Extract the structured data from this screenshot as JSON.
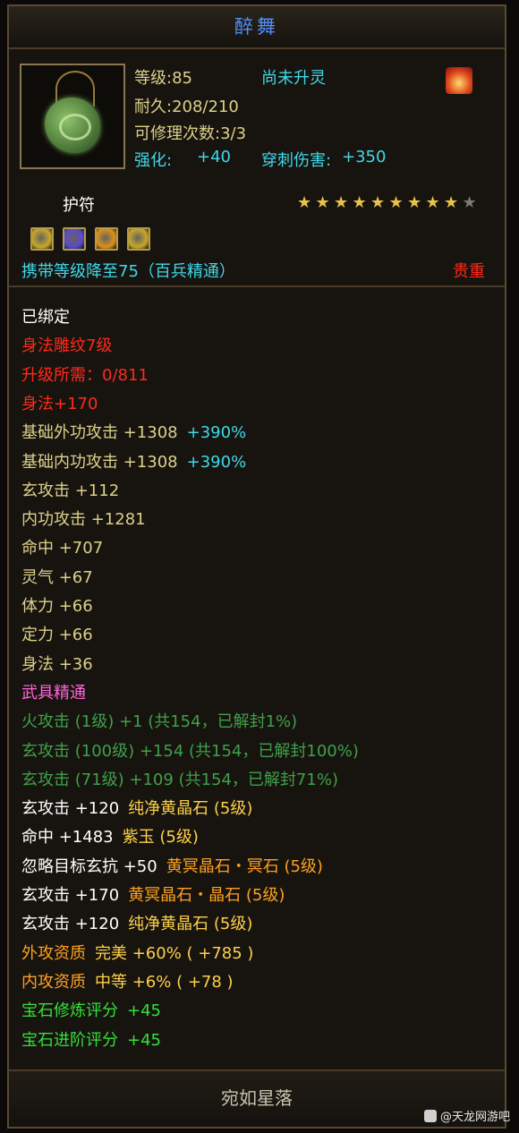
{
  "title": "醉舞",
  "item": {
    "level": "等级:85",
    "spirit": "尚未升灵",
    "durability": "耐久:208/210",
    "repair": "可修理次数:3/3",
    "enhance_label": "强化:",
    "enhance_value": "+40",
    "pierce_label": "穿刺伤害:",
    "pierce_value": "+350",
    "type": "护符",
    "stars_filled": 9,
    "stars_total": 10,
    "carry_level": "携带等级降至75（百兵精通）",
    "rarity": "贵重"
  },
  "gems": [
    "gem-yellow-icon",
    "gem-purple-icon",
    "gem-orange-icon",
    "gem-yellow-icon"
  ],
  "attrs": [
    {
      "text": "已绑定",
      "cls": "white"
    },
    {
      "text": "身法雕纹7级",
      "cls": "red"
    },
    {
      "text": "升级所需：0/811",
      "cls": "red"
    },
    {
      "text": "身法+170",
      "cls": "red"
    },
    {
      "text": "基础外功攻击 +1308",
      "cls": "gold",
      "extra": "+390%",
      "extra_cls": "cyan"
    },
    {
      "text": "基础内功攻击 +1308",
      "cls": "gold",
      "extra": "+390%",
      "extra_cls": "cyan"
    },
    {
      "text": "玄攻击 +112",
      "cls": "gold"
    },
    {
      "text": "内功攻击 +1281",
      "cls": "gold"
    },
    {
      "text": "命中 +707",
      "cls": "gold"
    },
    {
      "text": "灵气 +67",
      "cls": "gold"
    },
    {
      "text": "体力 +66",
      "cls": "gold"
    },
    {
      "text": "定力 +66",
      "cls": "gold"
    },
    {
      "text": "身法 +36",
      "cls": "gold"
    },
    {
      "text": "武具精通",
      "cls": "pink"
    },
    {
      "text": "火攻击 (1级) +1 (共154，已解封1%)",
      "cls": "dgreen"
    },
    {
      "text": "玄攻击 (100级) +154 (共154，已解封100%)",
      "cls": "dgreen"
    },
    {
      "text": "玄攻击 (71级) +109 (共154，已解封71%)",
      "cls": "dgreen"
    },
    {
      "text": "玄攻击 +120",
      "cls": "white",
      "extra": "纯净黄晶石 (5级)",
      "extra_cls": "yellow"
    },
    {
      "text": "命中 +1483",
      "cls": "white",
      "extra": "紫玉 (5级)",
      "extra_cls": "yellow"
    },
    {
      "text": "忽略目标玄抗 +50",
      "cls": "white",
      "extra": "黄冥晶石・冥石 (5级)",
      "extra_cls": "orange"
    },
    {
      "text": "玄攻击 +170",
      "cls": "white",
      "extra": "黄冥晶石・晶石 (5级)",
      "extra_cls": "orange"
    },
    {
      "text": "玄攻击 +120",
      "cls": "white",
      "extra": "纯净黄晶石 (5级)",
      "extra_cls": "yellow"
    },
    {
      "text": "外攻资质",
      "cls": "orange",
      "extra": "完美 +60% ( +785 )",
      "extra_cls": "yellow"
    },
    {
      "text": "内攻资质",
      "cls": "orange",
      "extra": "中等 +6% ( +78 )",
      "extra_cls": "yellow"
    },
    {
      "text": "宝石修炼评分",
      "cls": "bright",
      "extra": "+45",
      "extra_cls": "bright"
    },
    {
      "text": "宝石进阶评分",
      "cls": "bright",
      "extra": "+45",
      "extra_cls": "bright"
    }
  ],
  "footer": "宛如星落",
  "watermark": "@天龙网游吧"
}
